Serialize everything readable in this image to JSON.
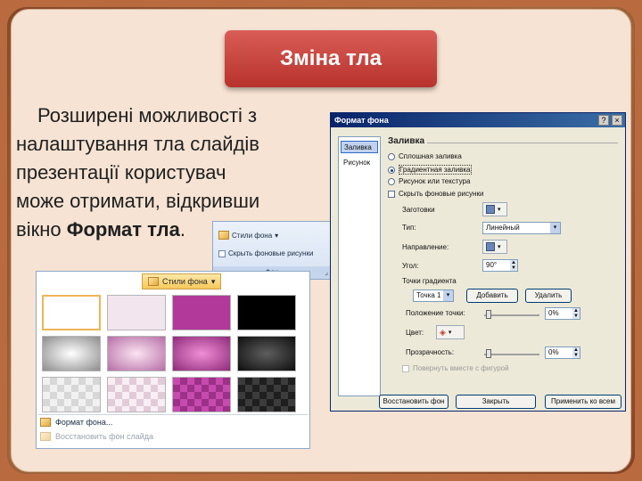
{
  "slide": {
    "title": "Зміна тла",
    "body_line1": "Розширені можливості з",
    "body_line2": "налаштування тла слайдів",
    "body_line3": "презентації користувач",
    "body_line4": "може отримати, відкривши",
    "body_line5_prefix": "вікно ",
    "body_line5_bold": "Формат тла",
    "body_line5_suffix": "."
  },
  "ribbon": {
    "styles_label": "Стили фона",
    "hide_graphics_label": "Скрыть фоновые рисунки",
    "group_label": "Фон"
  },
  "gallery": {
    "header_label": "Стили фона",
    "tiles": [
      {
        "style": "solid",
        "color": "#ffffff"
      },
      {
        "style": "solid",
        "color": "#f3e5ee"
      },
      {
        "style": "solid",
        "color": "#b2389a"
      },
      {
        "style": "solid",
        "color": "#000000"
      },
      {
        "style": "radial",
        "color": "#ffffff",
        "edge": "#8c8c8c"
      },
      {
        "style": "radial",
        "color": "#fbe3f1",
        "edge": "#b56ea6"
      },
      {
        "style": "radial",
        "color": "#f08fd6",
        "edge": "#8d2a7a"
      },
      {
        "style": "radial",
        "color": "#5e5e5e",
        "edge": "#0e0e0e"
      },
      {
        "style": "pattern",
        "color": "#f1f1f1",
        "edge": "#d7d7d7"
      },
      {
        "style": "pattern",
        "color": "#f8eef4",
        "edge": "#e2cbd9"
      },
      {
        "style": "pattern",
        "color": "#c54bae",
        "edge": "#9d3088"
      },
      {
        "style": "pattern",
        "color": "#3c3c3c",
        "edge": "#1f1f1f"
      }
    ],
    "format_cmd": "Формат фона...",
    "restore_cmd": "Восстановить фон слайда"
  },
  "dialog": {
    "title": "Формат фона",
    "help_btn": "?",
    "close_btn": "×",
    "nav": [
      "Заливка",
      "Рисунок"
    ],
    "fill_heading": "Заливка",
    "options": [
      {
        "label": "Сплошная заливка",
        "checked": false
      },
      {
        "label": "Градиентная заливка",
        "checked": true
      },
      {
        "label": "Рисунок или текстура",
        "checked": false
      }
    ],
    "hide_bg_label": "Скрыть фоновые рисунки",
    "preset_label": "Заготовки",
    "type_label": "Тип:",
    "type_value": "Линейный",
    "direction_label": "Направление:",
    "angle_label": "Угол:",
    "angle_value": "90°",
    "stops_label": "Точки градиента",
    "stop_value": "Точка 1",
    "add_btn": "Добавить",
    "remove_btn": "Удалить",
    "position_label": "Положение точки:",
    "position_value": "0%",
    "color_label": "Цвет:",
    "transparency_label": "Прозрачность:",
    "transparency_value": "0%",
    "rotate_label": "Повернуть вместе с фигурой",
    "reset_btn": "Восстановить фон",
    "close_action_btn": "Закрыть",
    "apply_all_btn": "Применить ко всем"
  }
}
